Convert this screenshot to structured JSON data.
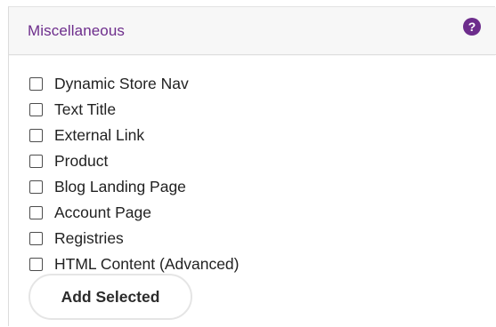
{
  "panel": {
    "title": "Miscellaneous",
    "help_icon_glyph": "?",
    "help_icon_name": "help-circle-icon"
  },
  "items": [
    {
      "label": "Dynamic Store Nav",
      "checked": false
    },
    {
      "label": "Text Title",
      "checked": false
    },
    {
      "label": "External Link",
      "checked": false
    },
    {
      "label": "Product",
      "checked": false
    },
    {
      "label": "Blog Landing Page",
      "checked": false
    },
    {
      "label": "Account Page",
      "checked": false
    },
    {
      "label": "Registries",
      "checked": false
    },
    {
      "label": "HTML Content (Advanced)",
      "checked": false
    }
  ],
  "actions": {
    "add_selected_label": "Add Selected"
  },
  "colors": {
    "accent": "#6d2d8c",
    "header_bg": "#f7f7f7",
    "text": "#222222"
  }
}
